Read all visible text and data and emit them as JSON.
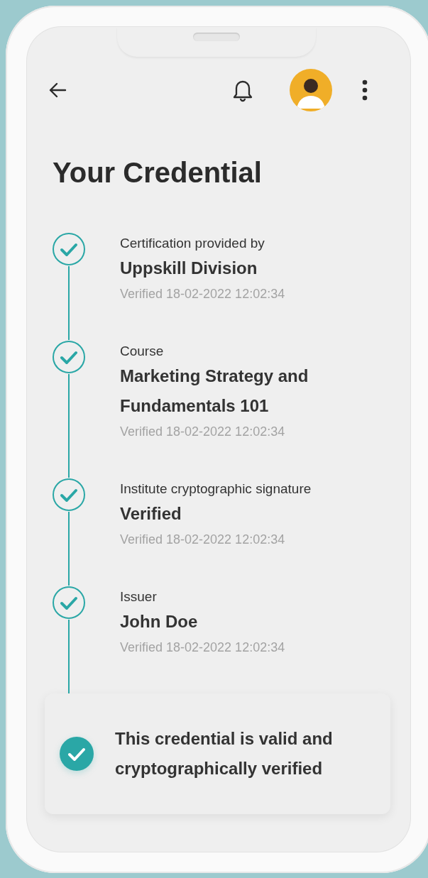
{
  "title": "Your Credential",
  "steps": [
    {
      "label": "Certification provided by",
      "value": "Uppskill Division",
      "verified": "Verified 18-02-2022 12:02:34",
      "checked": true
    },
    {
      "label": "Course",
      "value": "Marketing Strategy and Fundamentals 101",
      "verified": "Verified 18-02-2022 12:02:34",
      "checked": true
    },
    {
      "label": "Institute cryptographic signature",
      "value": "Verified",
      "verified": "Verified 18-02-2022 12:02:34",
      "checked": true
    },
    {
      "label": "Issuer",
      "value": "John Doe",
      "verified": "Verified 18-02-2022 12:02:34",
      "checked": true
    }
  ],
  "status": {
    "text": "This credential is valid and cryptographically verified",
    "verified": true
  }
}
